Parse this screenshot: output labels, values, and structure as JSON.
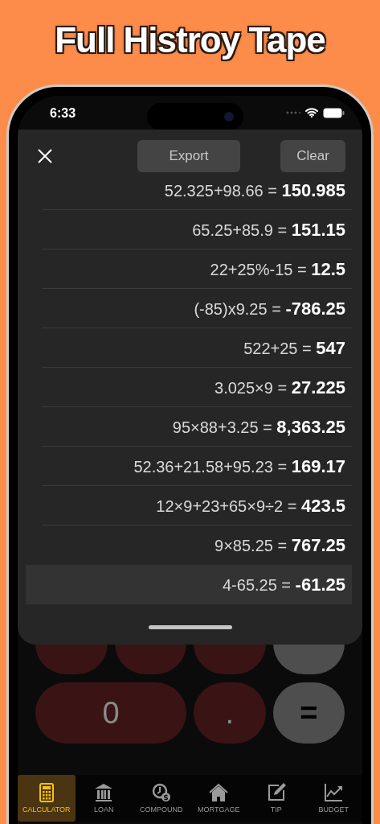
{
  "heading": "Full Histroy Tape",
  "status_bar": {
    "time": "6:33"
  },
  "sheet": {
    "buttons": [
      "Export",
      "Clear"
    ],
    "entries": [
      {
        "text": "52.325+98.66 = **150.985**",
        "selected": false
      },
      {
        "text": "65.25+85.9 = **151.15**",
        "selected": false
      },
      {
        "text": "22+25%-15 = **12.5**",
        "selected": false
      },
      {
        "text": "(-85)x9.25 = **-786.25**",
        "selected": false
      },
      {
        "text": "522+25 = **547**",
        "selected": false
      },
      {
        "text": "3.025×9 = **27.225**",
        "selected": false
      },
      {
        "text": "95×88+3.25 = **8,363.25**",
        "selected": false
      },
      {
        "text": "52.36+21.58+95.23 = **169.17**",
        "selected": false
      },
      {
        "text": "12×9+23+65×9÷2 = **423.5**",
        "selected": false
      },
      {
        "text": "9×85.25 = **767.25**",
        "selected": false
      },
      {
        "text": "4-65.25 = **-61.25**",
        "selected": true
      }
    ]
  },
  "keypad": [
    {
      "kind": "digit",
      "wide": false
    },
    {
      "kind": "digit",
      "wide": false
    },
    {
      "kind": "digit",
      "wide": false
    },
    {
      "kind": "operator",
      "wide": false
    },
    {
      "label": "0",
      "kind": "digit",
      "wide": true
    },
    {
      "label": ".",
      "kind": "digit",
      "wide": false
    },
    {
      "label": "=",
      "kind": "operator",
      "wide": false
    }
  ],
  "tabs": [
    {
      "label": "CALCULATOR",
      "selected": true
    },
    {
      "label": "LOAN",
      "selected": false
    },
    {
      "label": "COMPOUND",
      "selected": false
    },
    {
      "label": "MORTGAGE",
      "selected": false
    },
    {
      "label": "TIP",
      "selected": false
    },
    {
      "label": "BUDGET",
      "selected": false
    }
  ]
}
